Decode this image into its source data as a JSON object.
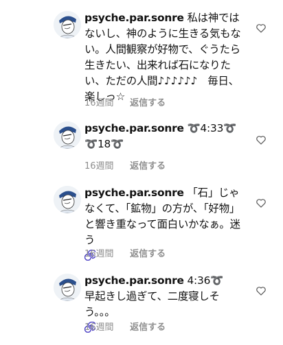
{
  "comments": [
    {
      "username": "psyche.par.sonre",
      "text_parts": [
        "私は神ではないし、神のように生きる気もない。人間観察が好物で、ぐうたら生きたい、出来れば石になりたい、ただの人間♪♪♪♪♪♪　毎日、楽しっ☆"
      ],
      "time": "16週間",
      "reply": "返信する"
    },
    {
      "username": "psyche.par.sonre",
      "text_parts": [
        "➰",
        "4:33",
        "➰",
        "➰",
        "18",
        "➰"
      ],
      "time": "16週間",
      "reply": "返信する"
    },
    {
      "username": "psyche.par.sonre",
      "text_parts": [
        "「石」じゃなくて、「鉱物」の方が、「好物」と響き重なって面白いかなぁ。迷う"
      ],
      "time": "16週間",
      "reply": "返信する"
    },
    {
      "username": "psyche.par.sonre",
      "text_parts": [
        "4:36",
        "➰",
        "　早起きし過ぎて、二度寝しそう。。。"
      ],
      "time": "16週間",
      "reply": "返信する"
    }
  ],
  "icons": {
    "like": "heart-outline-icon",
    "swirl": "cyclone-emoji-icon",
    "loop": "curly-loop-emoji"
  },
  "colors": {
    "meta": "#8e8e8e",
    "loop": "#e8a720",
    "swirl": "#4a3fc4"
  }
}
